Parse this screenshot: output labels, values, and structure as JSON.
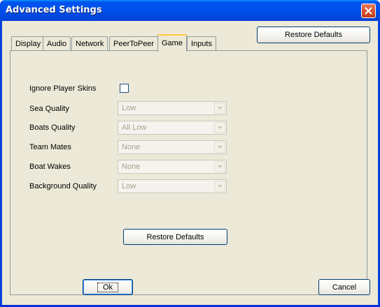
{
  "window": {
    "title": "Advanced Settings"
  },
  "tabs": [
    {
      "label": "Display"
    },
    {
      "label": "Audio"
    },
    {
      "label": "Network"
    },
    {
      "label": "PeerToPeer"
    },
    {
      "label": "Game",
      "active": true
    },
    {
      "label": "Inputs"
    }
  ],
  "top_restore_label": "Restore Defaults",
  "game": {
    "ignore_skins_label": "Ignore Player Skins",
    "ignore_skins_checked": false,
    "settings": [
      {
        "label": "Sea Quality",
        "value": "Low"
      },
      {
        "label": "Boats Quality",
        "value": "All Low"
      },
      {
        "label": "Team Mates",
        "value": "None"
      },
      {
        "label": "Boat Wakes",
        "value": "None"
      },
      {
        "label": "Background Quality",
        "value": "Low"
      }
    ],
    "restore_label": "Restore Defaults"
  },
  "footer": {
    "ok_label": "Ok",
    "cancel_label": "Cancel"
  },
  "icons": {
    "close": "close-icon",
    "dropdown": "dropdown-arrow-icon"
  },
  "colors": {
    "titlebar": "#0053ee",
    "client": "#ece9d8",
    "active_tab_accent": "#ffc83c",
    "close_button": "#d9542e"
  }
}
